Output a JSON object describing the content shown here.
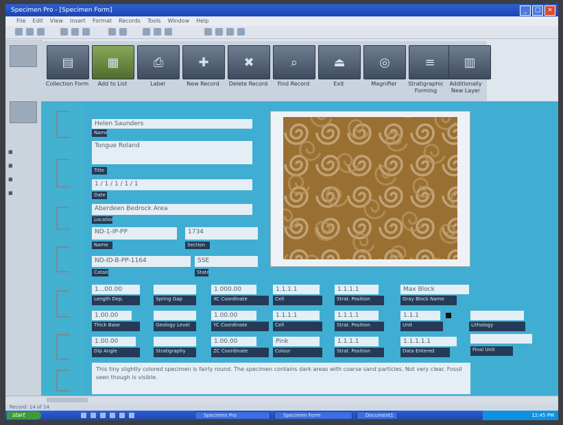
{
  "window": {
    "title": "Specimen Pro - [Specimen Form]",
    "min": "_",
    "max": "□",
    "close": "×"
  },
  "menu": [
    "File",
    "Edit",
    "View",
    "Insert",
    "Format",
    "Records",
    "Tools",
    "Window",
    "Help"
  ],
  "ribbon": [
    {
      "label": "Collection Form",
      "icon": "form-icon"
    },
    {
      "label": "Add to List",
      "icon": "list-add-icon"
    },
    {
      "label": "Label",
      "icon": "printer-icon"
    },
    {
      "label": "New Record",
      "icon": "new-record-icon"
    },
    {
      "label": "Delete Record",
      "icon": "delete-icon"
    },
    {
      "label": "Find Record",
      "icon": "find-icon"
    },
    {
      "label": "Exit",
      "icon": "exit-icon"
    },
    {
      "label": "Magnifier",
      "icon": "magnifier-icon"
    },
    {
      "label": "Stratigraphic Forming",
      "icon": "strata-icon"
    },
    {
      "label": "Additionally New Layer",
      "icon": "layer-icon"
    }
  ],
  "record": {
    "name": "Helen Saunders",
    "name_label": "Name",
    "title": "Tongue Roland",
    "title_label": "Title",
    "date": "1 / 1 / 1 / 1 / 1",
    "date_label": "Date",
    "location": "Aberdeen Bedrock Area",
    "location_label": "Location",
    "id_number": "ND-1-IP-PP",
    "id_label": "Name",
    "section": "1734",
    "section_label": "Section",
    "catalog": "ND-ID-B-PP-1164",
    "catalog_label": "Catalog",
    "state": "SSE",
    "state_label": "State"
  },
  "measurements": [
    {
      "value": "1...00.00",
      "label": "Length Dep."
    },
    {
      "value": "",
      "label": "Spring Gap"
    },
    {
      "value": "1.000.00",
      "label": "XC Coordinate"
    },
    {
      "value": "1.1.1.1",
      "label": "Cell"
    },
    {
      "value": "1.1.1.1",
      "label": "Strat. Position"
    },
    {
      "value": "Max Block",
      "label": "Gray Block Name"
    },
    {
      "value": "1.00.00",
      "label": "Thick Base"
    },
    {
      "value": "",
      "label": "Geology Level"
    },
    {
      "value": "1.00.00",
      "label": "YC Coordinate"
    },
    {
      "value": "1.1.1.1",
      "label": "Cell"
    },
    {
      "value": "1.1.1.1",
      "label": "Strat. Position"
    },
    {
      "value": "1.1.1",
      "label": "Unit"
    },
    {
      "value": "",
      "label": "Lithology"
    },
    {
      "value": "1.00.00",
      "label": "Dip Angle"
    },
    {
      "value": "",
      "label": "Stratigraphy"
    },
    {
      "value": "1.00.00",
      "label": "ZC Coordinate"
    },
    {
      "value": "Pink",
      "label": "Colour"
    },
    {
      "value": "1.1.1.1",
      "label": "Strat. Position"
    },
    {
      "value": "1.1.1.1.1",
      "label": "Data Entered"
    },
    {
      "value": "",
      "label": "Final Unit"
    }
  ],
  "notes": "This tiny slightly colored specimen is fairly round. The specimen contains dark areas with coarse sand particles. Not very clear. Fossil seen though is visible.",
  "status": "Record: 14 of 14",
  "taskbar": {
    "start": "start",
    "tasks": [
      "Specimen Pro",
      "Specimen Form",
      "Document1"
    ],
    "clock": "12:45 PM"
  },
  "colors": {
    "panel": "#40aed2",
    "label_bg": "#243a56",
    "field_bg": "#e6eef5",
    "ribbon_btn": "#4f5c70"
  }
}
